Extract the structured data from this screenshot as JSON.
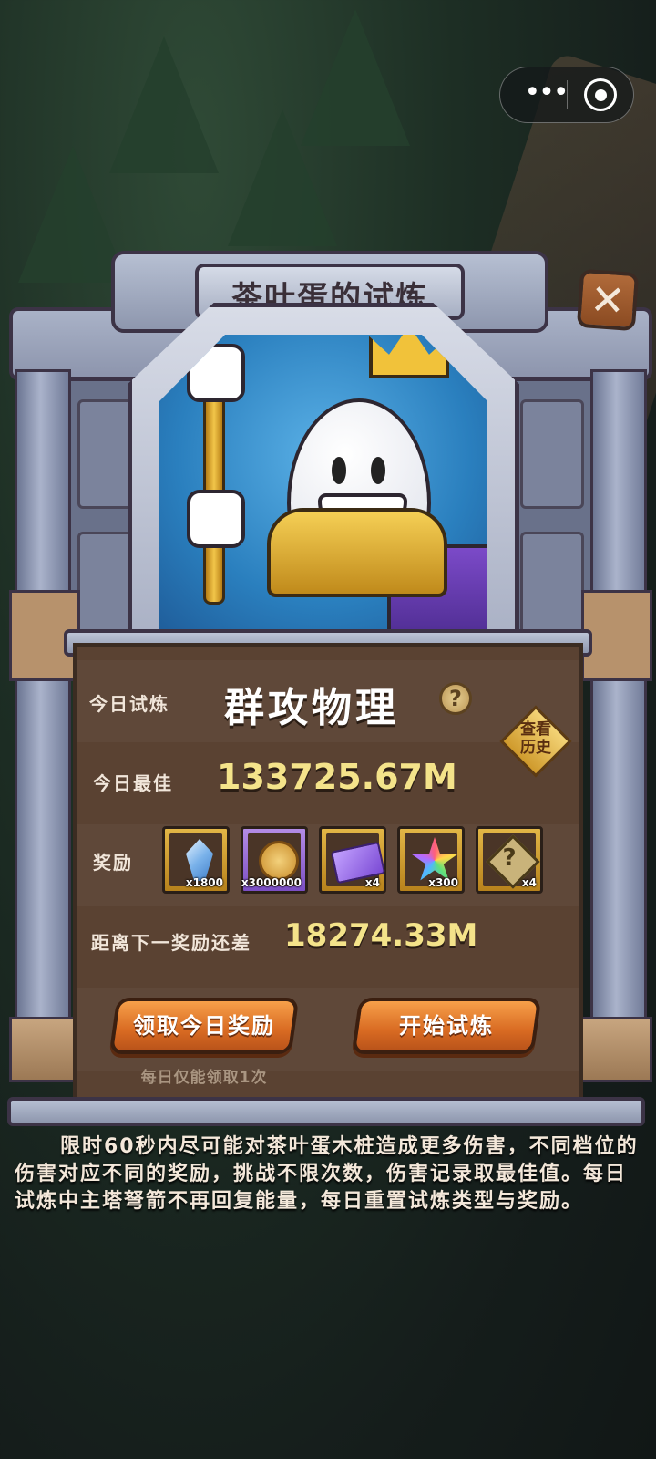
{
  "capsule": {
    "more_glyph": "•••",
    "more_label": "more-options",
    "close_label": "close-miniprogram"
  },
  "dialog": {
    "title": "茶叶蛋的试炼",
    "close_glyph": "✕",
    "today_trial_label": "今日试炼",
    "today_trial_value": "群攻物理",
    "help_glyph": "?",
    "history_label_line1": "查看",
    "history_label_line2": "历史",
    "today_best_label": "今日最佳",
    "today_best_value": "133725.67M",
    "rewards_label": "奖励",
    "rewards": [
      {
        "icon": "blue-crystal-icon",
        "qty": "x1800",
        "frame": "gold"
      },
      {
        "icon": "gold-coin-icon",
        "qty": "x3000000",
        "frame": "purple"
      },
      {
        "icon": "purple-ticket-icon",
        "qty": "x4",
        "frame": "gold"
      },
      {
        "icon": "rainbow-star-icon",
        "qty": "x300",
        "frame": "gold"
      },
      {
        "icon": "mystery-box-icon",
        "qty": "x4",
        "frame": "gold"
      }
    ],
    "gap_label": "距离下一奖励还差",
    "gap_value": "18274.33M",
    "claim_button": "领取今日奖励",
    "start_button": "开始试炼",
    "claim_note": "每日仅能领取1次",
    "description": "限时60秒内尽可能对茶叶蛋木桩造成更多伤害，不同档位的伤害对应不同的奖励，挑战不限次数，伤害记录取最佳值。每日试炼中主塔弩箭不再回复能量，每日重置试炼类型与奖励。"
  },
  "colors": {
    "value_yellow": "#f4e38a",
    "label": "#f1e6da",
    "panel_brown": "#5a4232",
    "button_orange": "#e07a2e"
  }
}
